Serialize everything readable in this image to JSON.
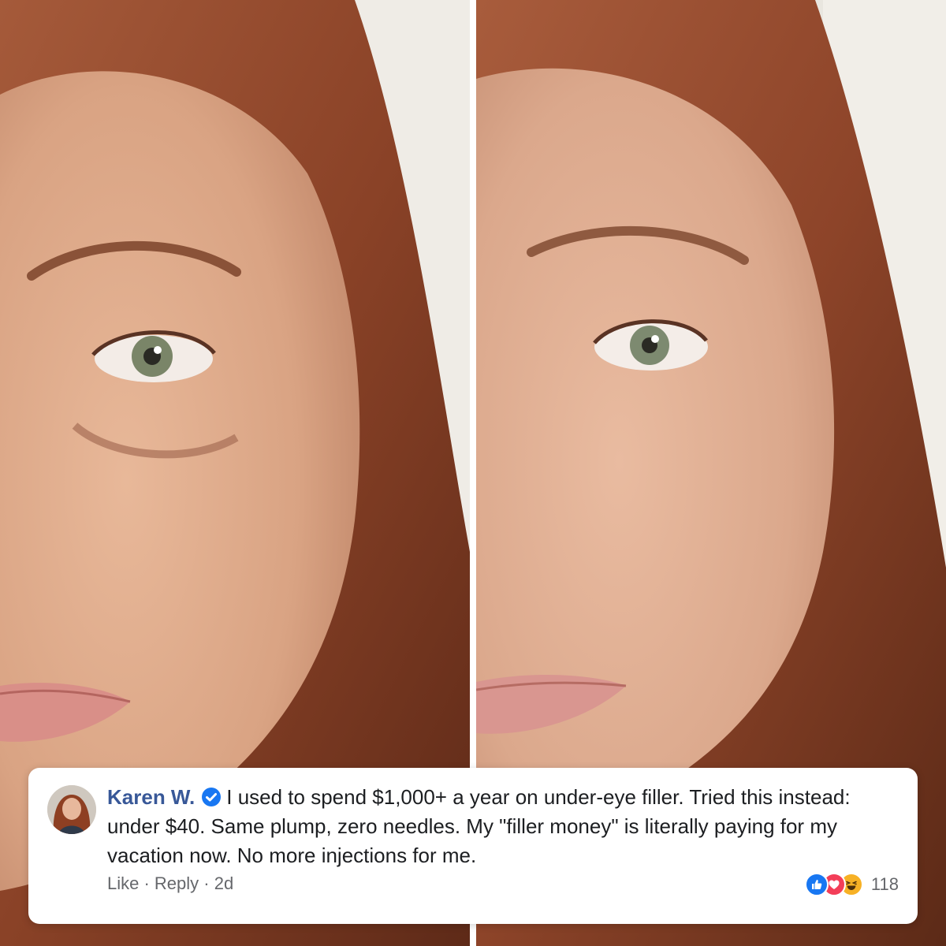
{
  "photos": {
    "before_alt": "before photo",
    "after_alt": "after photo"
  },
  "comment": {
    "author": "Karen W.",
    "verified_icon": "verified-badge-icon",
    "text": "I used to spend $1,000+ a year on under-eye filler. Tried this instead: under $40. Same plump, zero needles. My \"filler money\" is literally paying for my vacation now. No more injections for me.",
    "actions": {
      "like_label": "Like",
      "separator": " · ",
      "reply_label": "Reply",
      "time": "2d"
    },
    "reactions": {
      "icons": [
        "like-reaction-icon",
        "love-reaction-icon",
        "haha-reaction-icon"
      ],
      "count": "118"
    }
  },
  "colors": {
    "author_link": "#385898",
    "like_blue": "#1877f2",
    "love_red": "#f33e58",
    "haha_yellow": "#f7b125",
    "muted_text": "#65676b"
  }
}
